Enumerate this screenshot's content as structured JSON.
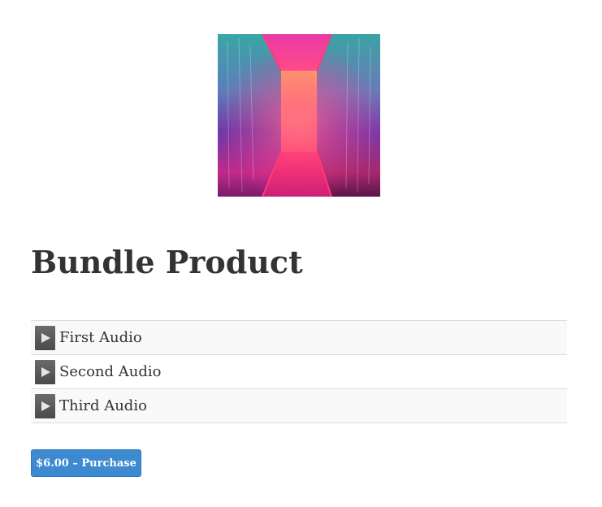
{
  "product": {
    "title": "Bundle Product",
    "image_description_icon": "neon-corridor-image"
  },
  "tracks": [
    {
      "title": "First Audio",
      "icon": "play-icon"
    },
    {
      "title": "Second Audio",
      "icon": "play-icon"
    },
    {
      "title": "Third Audio",
      "icon": "play-icon"
    }
  ],
  "purchase": {
    "label": "$6.00 – Purchase",
    "color": "#3d8ad1"
  }
}
